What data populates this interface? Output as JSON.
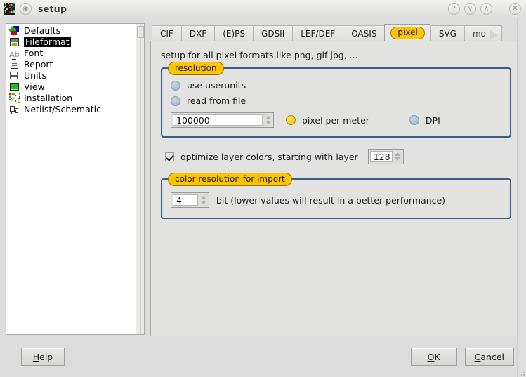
{
  "window": {
    "title": "setup",
    "app_icon": "application-icon",
    "controls": [
      {
        "name": "help-button",
        "glyph": "?"
      },
      {
        "name": "minimize-button",
        "glyph": "∨"
      },
      {
        "name": "maximize-button",
        "glyph": "∧"
      },
      {
        "name": "close-button",
        "glyph": "✕"
      }
    ]
  },
  "sidebar": {
    "items": [
      {
        "label": "Defaults",
        "icon": "defaults-icon",
        "selected": false
      },
      {
        "label": "Fileformat",
        "icon": "floppy-disk-icon",
        "selected": true
      },
      {
        "label": "Font",
        "icon": "font-ab-icon",
        "selected": false
      },
      {
        "label": "Report",
        "icon": "report-clipboard-icon",
        "selected": false
      },
      {
        "label": "Units",
        "icon": "units-caliper-icon",
        "selected": false
      },
      {
        "label": "View",
        "icon": "monitor-icon",
        "selected": false
      },
      {
        "label": "Installation",
        "icon": "installation-icon",
        "selected": false
      },
      {
        "label": "Netlist/Schematic",
        "icon": "netlist-schematic-icon",
        "selected": false
      }
    ]
  },
  "tabs": [
    {
      "label": "CIF",
      "active": false
    },
    {
      "label": "DXF",
      "active": false
    },
    {
      "label": "(E)PS",
      "active": false
    },
    {
      "label": "GDSII",
      "active": false
    },
    {
      "label": "LEF/DEF",
      "active": false
    },
    {
      "label": "OASIS",
      "active": false
    },
    {
      "label": "pixel",
      "active": true
    },
    {
      "label": "SVG",
      "active": false
    },
    {
      "label": "mo",
      "active": false
    }
  ],
  "main": {
    "intro": "setup for all pixel formats like png, gif jpg, ...",
    "resolution_group": {
      "title": "resolution",
      "options": [
        {
          "label": "use userunits",
          "selected": false
        },
        {
          "label": "read from file",
          "selected": false
        }
      ],
      "value_field": {
        "value": "100000",
        "placeholder": ""
      },
      "unit_options": [
        {
          "label": "pixel per meter",
          "selected": true
        },
        {
          "label": "DPI",
          "selected": false
        }
      ]
    },
    "optimize_row": {
      "checked": true,
      "label": "optimize layer colors, starting with layer",
      "layer_value": "128"
    },
    "color_resolution_group": {
      "title": "color resolution for import",
      "bit_value": "4",
      "description": "bit (lower values will result in a better performance)"
    }
  },
  "footer": {
    "help": {
      "pre": "",
      "mnemonic": "H",
      "post": "elp"
    },
    "ok": {
      "pre": "",
      "mnemonic": "O",
      "post": "K"
    },
    "cancel": {
      "pre": "",
      "mnemonic": "C",
      "post": "ancel"
    }
  },
  "colors": {
    "accent_yellow": "#ffc400",
    "group_border": "#3b5b8c",
    "window_bg": "#dcdcdc",
    "panel_bg": "#e2e2e0",
    "radio_off": "#9fb0c8"
  }
}
